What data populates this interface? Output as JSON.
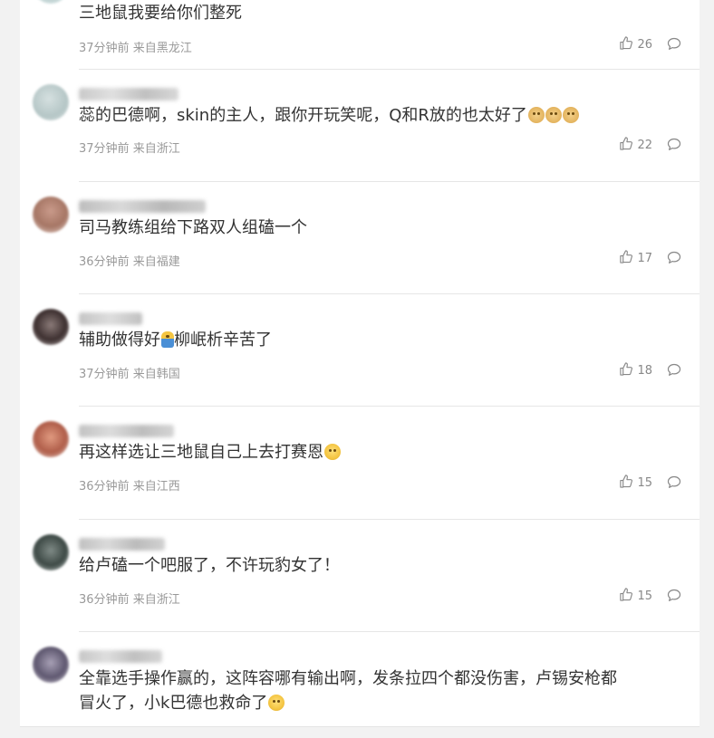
{
  "colors": {
    "text": "#333333",
    "meta": "#999999",
    "divider": "#e6e6e6",
    "background": "#f2f2f2"
  },
  "comments": [
    {
      "text": "三地鼠我要给你们整死",
      "time": "37分钟前",
      "location": "来自黑龙江",
      "likes": "26",
      "emoji": []
    },
    {
      "text": "蕊的巴德啊，skin的主人，跟你开玩笑呢，Q和R放的也太好了",
      "time": "37分钟前",
      "location": "来自浙江",
      "likes": "22",
      "emoji": [
        "dog-emoji",
        "dog-emoji",
        "dog-emoji"
      ]
    },
    {
      "text": "司马教练组给下路双人组磕一个",
      "time": "36分钟前",
      "location": "来自福建",
      "likes": "17",
      "emoji": []
    },
    {
      "text_before": "辅助做得好",
      "text_after": "柳岷析辛苦了",
      "time": "37分钟前",
      "location": "来自韩国",
      "likes": "18",
      "emoji": [
        "kid-emoji"
      ]
    },
    {
      "text": "再这样选让三地鼠自己上去打赛恩",
      "time": "36分钟前",
      "location": "来自江西",
      "likes": "15",
      "emoji": [
        "grin-emoji"
      ]
    },
    {
      "text": "给卢磕一个吧服了，不许玩豹女了！",
      "time": "36分钟前",
      "location": "来自浙江",
      "likes": "15",
      "emoji": []
    },
    {
      "text_line1": "全靠选手操作赢的，这阵容哪有输出啊，发条拉四个都没伤害，卢锡安枪都",
      "text_line2": "冒火了，小k巴德也救命了",
      "emoji": [
        "smile-emoji"
      ]
    }
  ]
}
